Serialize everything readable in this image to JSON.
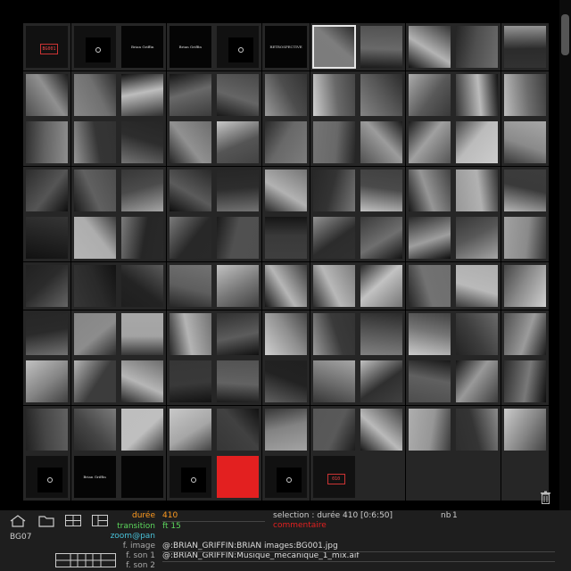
{
  "grid": {
    "rows": 10,
    "cols": 11,
    "cells": [
      "t-red",
      "sq-dot",
      "title",
      "title",
      "sq-dot",
      "title",
      "photo-sel",
      "photo",
      "photo",
      "photo",
      "photo",
      "photo",
      "photo",
      "photo",
      "photo",
      "photo",
      "photo",
      "photo",
      "photo",
      "photo",
      "photo",
      "photo",
      "photo",
      "photo",
      "photo",
      "photo",
      "photo",
      "photo",
      "photo",
      "photo",
      "photo",
      "photo",
      "photo",
      "photo",
      "photo",
      "photo",
      "photo",
      "photo",
      "photo",
      "photo",
      "photo",
      "photo",
      "photo",
      "photo",
      "photo",
      "photo",
      "photo",
      "photo",
      "photo",
      "photo",
      "photo",
      "photo",
      "photo",
      "photo",
      "photo",
      "photo",
      "photo",
      "photo",
      "photo",
      "photo",
      "photo",
      "photo",
      "photo",
      "photo",
      "photo",
      "photo",
      "photo",
      "photo",
      "photo",
      "photo",
      "photo",
      "photo",
      "photo",
      "photo",
      "photo",
      "photo",
      "photo",
      "photo",
      "photo",
      "photo",
      "photo",
      "photo",
      "photo",
      "photo",
      "photo",
      "photo",
      "photo",
      "photo",
      "photo",
      "photo",
      "photo",
      "photo",
      "photo",
      "photo",
      "photo",
      "photo",
      "photo",
      "photo",
      "photo",
      "sq-dot",
      "title",
      "title",
      "sq-dot",
      "red",
      "sq-dot",
      "t-red",
      "empty",
      "empty",
      "empty",
      "empty"
    ],
    "tile_labels": {
      "t-red-top": "BG001",
      "title-2": "Brian Griffin",
      "title-3": "Brian Griffin",
      "title-5": "RETROSPECTIVE",
      "title-r10-1": "Brian Griffin",
      "title-r10-2": "",
      "t-red-bottom": "010"
    }
  },
  "colors": {
    "background": "#000000",
    "cell": "#262626",
    "panel": "#1e1e1e",
    "orange": "#ff9a1f",
    "green": "#5cd65c",
    "cyan": "#48c0d8",
    "red": "#e32020",
    "label_grey": "#a9a9a9"
  },
  "panel": {
    "item_name": "BG07",
    "duration_label": "durée",
    "duration_value": "410",
    "transition_label": "transition",
    "transition_value": "ft 15",
    "zoom_label": "zoom@pan",
    "image_label": "f. image",
    "image_path": "@:BRIAN_GRIFFIN:BRIAN images:BG001.jpg",
    "sound1_label": "f. son 1",
    "sound1_path": "@:BRIAN_GRIFFIN:Musique_mecanique_1_mix.aif",
    "sound2_label": "f. son 2",
    "selection_label": "selection : durée",
    "selection_value": "410 [0:6:50]",
    "nb_label": "nb",
    "nb_value": "1",
    "comment_label": "commentaire"
  },
  "icons": [
    "home-icon",
    "folder-icon",
    "layout-icon",
    "layout-alt-icon",
    "trash-icon",
    "table-grid-icon"
  ]
}
